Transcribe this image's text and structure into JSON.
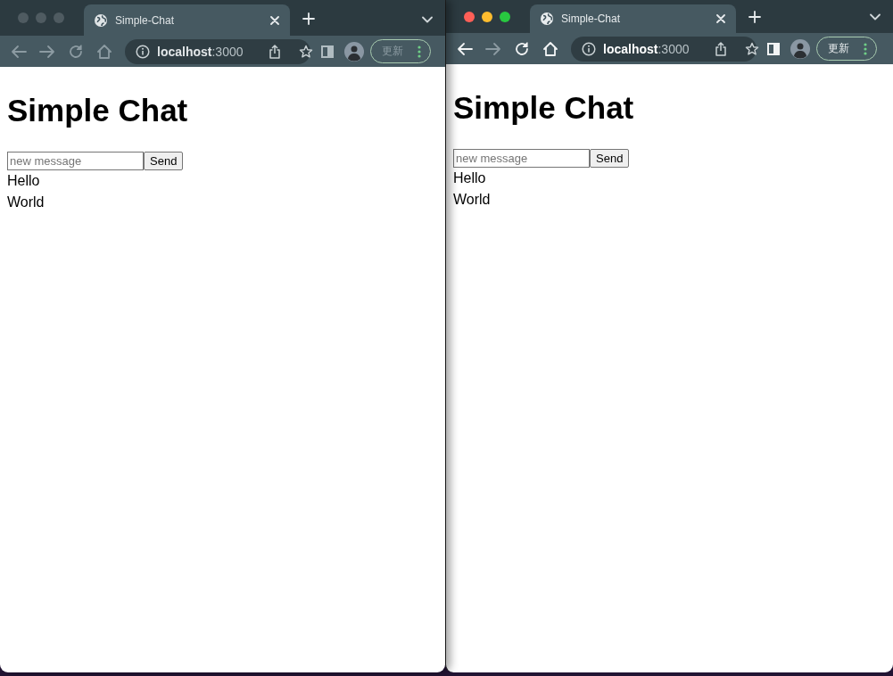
{
  "windows": [
    {
      "active": false,
      "tab": {
        "title": "Simple-Chat"
      },
      "toolbar": {
        "host": "localhost",
        "port": ":3000",
        "update_label": "更新"
      },
      "page": {
        "heading": "Simple Chat",
        "input": {
          "placeholder": "new message"
        },
        "send_label": "Send",
        "messages": [
          "Hello",
          "World"
        ]
      }
    },
    {
      "active": true,
      "tab": {
        "title": "Simple-Chat"
      },
      "toolbar": {
        "forward_disabled": true,
        "host": "localhost",
        "port": ":3000",
        "update_label": "更新"
      },
      "page": {
        "heading": "Simple Chat",
        "input": {
          "placeholder": "new message"
        },
        "send_label": "Send",
        "messages": [
          "Hello",
          "World"
        ]
      }
    }
  ]
}
